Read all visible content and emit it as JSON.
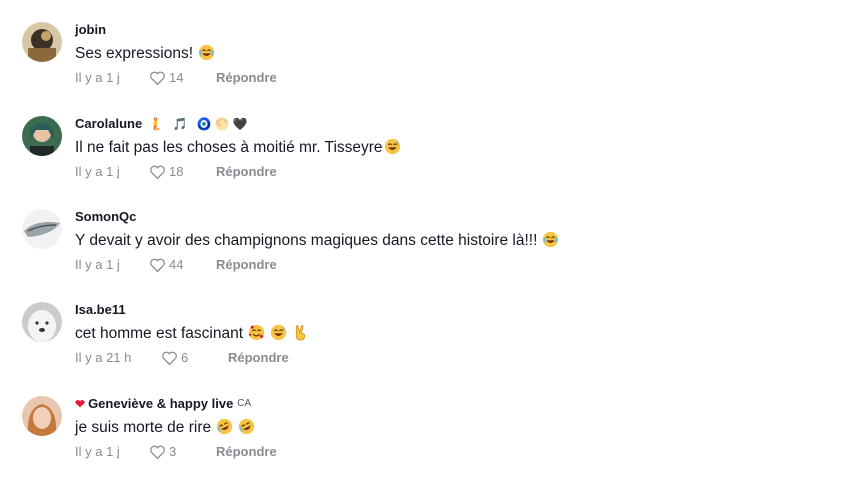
{
  "comments": [
    {
      "username": "jobin",
      "badges": "",
      "region": "",
      "text": "Ses expressions!",
      "emojis": [
        "laughing-face"
      ],
      "time": "Il y a 1 j",
      "likes": "14",
      "reply_label": "Répondre"
    },
    {
      "username": "Carolalune",
      "badges": "🧜 🎵 🧿🌕🖤",
      "region": "",
      "text": "Il ne fait pas les choses à moitié mr. Tisseyre",
      "emojis": [
        "grinning-sweat-face"
      ],
      "time": "Il y a 1 j",
      "likes": "18",
      "reply_label": "Répondre"
    },
    {
      "username": "SomonQc",
      "badges": "",
      "region": "",
      "text": "Y devait y avoir des champignons magiques dans cette histoire là!!!",
      "emojis": [
        "laughing-face"
      ],
      "time": "Il y a 1 j",
      "likes": "44",
      "reply_label": "Répondre"
    },
    {
      "username": "Isa.be11",
      "badges": "",
      "region": "",
      "text": "cet homme est fascinant",
      "emojis": [
        "smiling-face-with-hearts",
        "grinning-sweat-face",
        "victory-hand"
      ],
      "time": "Il y a 21 h",
      "likes": "6",
      "reply_label": "Répondre"
    },
    {
      "username": "Geneviève & happy live",
      "badges": "❤",
      "region": "CA",
      "text": "je suis morte de rire",
      "emojis": [
        "rolling-laughing-face",
        "rolling-laughing-face"
      ],
      "time": "Il y a 1 j",
      "likes": "3",
      "reply_label": "Répondre"
    }
  ],
  "colors": {
    "text": "#161823",
    "meta": "#8a8b91",
    "emoji_yellow": "#f6c343",
    "heart": "#e3173c"
  }
}
